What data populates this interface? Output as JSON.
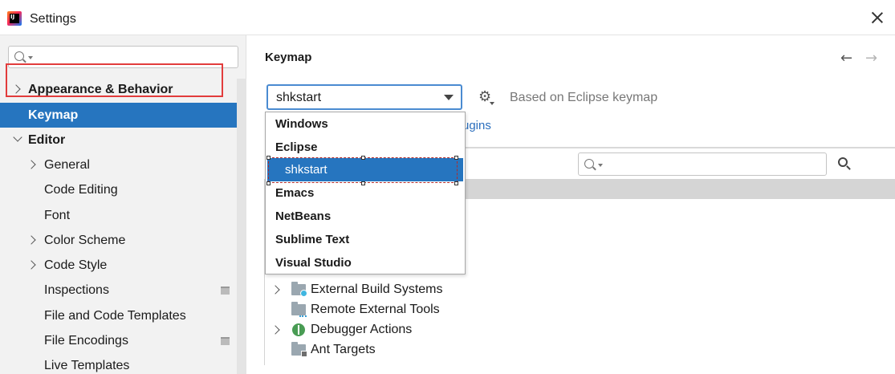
{
  "window": {
    "title": "Settings"
  },
  "sidebar": {
    "search_placeholder": "",
    "items": [
      {
        "label": "Appearance & Behavior",
        "bold": true,
        "chevron": "right",
        "level": 0
      },
      {
        "label": "Keymap",
        "bold": true,
        "chevron": "none",
        "level": 0,
        "selected": true
      },
      {
        "label": "Editor",
        "bold": true,
        "chevron": "down",
        "level": 0
      },
      {
        "label": "General",
        "bold": false,
        "chevron": "right",
        "level": 1
      },
      {
        "label": "Code Editing",
        "bold": false,
        "chevron": "none",
        "level": 1
      },
      {
        "label": "Font",
        "bold": false,
        "chevron": "none",
        "level": 1
      },
      {
        "label": "Color Scheme",
        "bold": false,
        "chevron": "right",
        "level": 1
      },
      {
        "label": "Code Style",
        "bold": false,
        "chevron": "right",
        "level": 1
      },
      {
        "label": "Inspections",
        "bold": false,
        "chevron": "none",
        "level": 1,
        "project_icon": true
      },
      {
        "label": "File and Code Templates",
        "bold": false,
        "chevron": "none",
        "level": 1
      },
      {
        "label": "File Encodings",
        "bold": false,
        "chevron": "none",
        "level": 1,
        "project_icon": true
      },
      {
        "label": "Live Templates",
        "bold": false,
        "chevron": "none",
        "level": 1
      }
    ]
  },
  "main": {
    "title": "Keymap",
    "nav": {
      "back_icon": "arrow-left-icon",
      "forward_icon": "arrow-right-icon"
    },
    "keymap_combo": {
      "value": "shkstart"
    },
    "based_on": "Based on Eclipse keymap",
    "plugins_link": "ugins",
    "action_search_placeholder": "",
    "dropdown": {
      "options": [
        "Windows",
        "Eclipse",
        "shkstart",
        "Emacs",
        "NetBeans",
        "Sublime Text",
        "Visual Studio"
      ],
      "selected": "shkstart"
    },
    "action_tree": [
      {
        "label": "External Build Systems",
        "expandable": true,
        "icon": "folder-gear-icon"
      },
      {
        "label": "Remote External Tools",
        "expandable": false,
        "icon": "folder-remote-icon"
      },
      {
        "label": "Debugger Actions",
        "expandable": true,
        "icon": "bug-icon"
      },
      {
        "label": "Ant Targets",
        "expandable": false,
        "icon": "folder-ant-icon"
      }
    ]
  },
  "colors": {
    "selection": "#2675bf",
    "highlight_border": "#e23c3c",
    "link": "#2a6ebd"
  }
}
